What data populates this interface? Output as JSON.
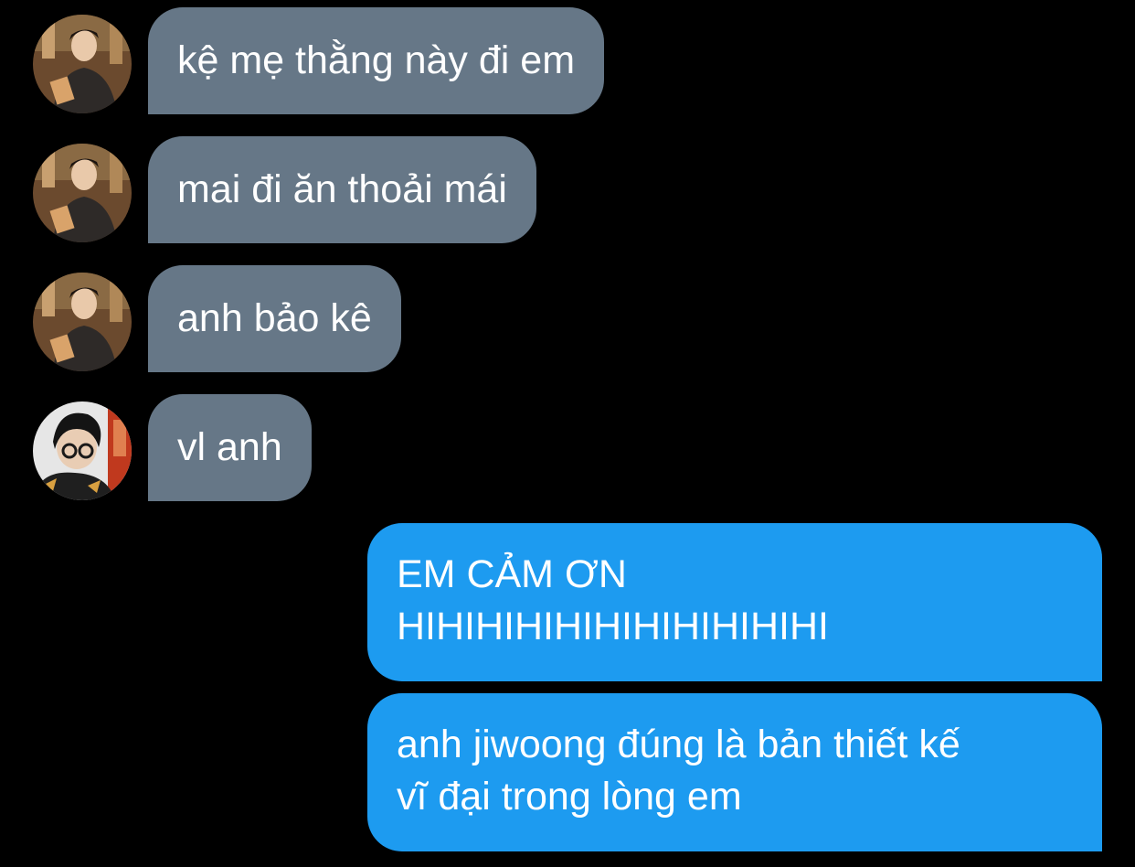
{
  "conversation": {
    "incoming": [
      {
        "avatar": "avatar-jiwoong",
        "text": "kệ mẹ thằng này đi em"
      },
      {
        "avatar": "avatar-jiwoong",
        "text": "mai đi ăn thoải mái"
      },
      {
        "avatar": "avatar-jiwoong",
        "text": "anh bảo kê"
      },
      {
        "avatar": "avatar-glasses",
        "text": "vl anh"
      }
    ],
    "outgoing": [
      {
        "lines": [
          "EM CẢM ƠN",
          "HIHIHIHIHIHIHIHIHIHIHI"
        ]
      },
      {
        "lines": [
          "anh jiwoong đúng là bản thiết kế",
          "vĩ đại trong lòng em"
        ]
      }
    ]
  },
  "colors": {
    "background": "#000000",
    "incoming_bubble": "#667787",
    "outgoing_bubble": "#1d9bf0",
    "text": "#ffffff"
  }
}
